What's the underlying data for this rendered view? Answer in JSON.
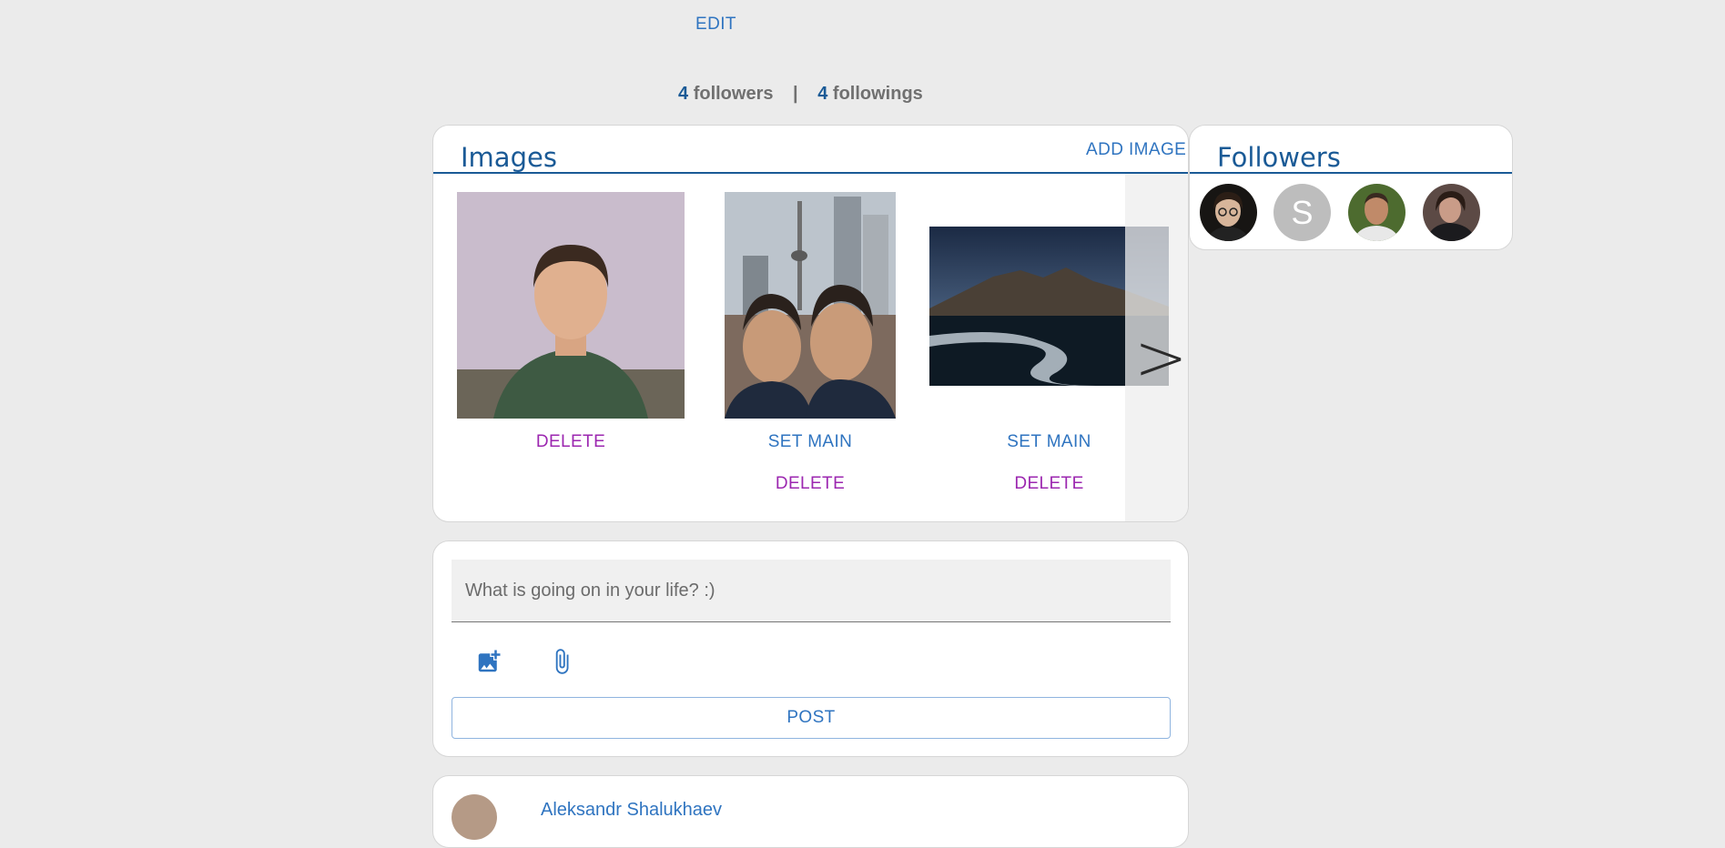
{
  "profile": {
    "edit_label": "EDIT",
    "followers_count": "4",
    "followers_label": "followers",
    "separator": "|",
    "followings_count": "4",
    "followings_label": "followings"
  },
  "images_card": {
    "title": "Images",
    "add_label": "ADD IMAGE",
    "items": [
      {
        "alt": "portrait-photo",
        "actions": [
          "DELETE"
        ]
      },
      {
        "alt": "city-selfie-photo",
        "actions": [
          "SET MAIN",
          "DELETE"
        ]
      },
      {
        "alt": "black-sand-beach-landscape",
        "actions": [
          "SET MAIN",
          "DELETE"
        ]
      }
    ],
    "next_icon": "chevron-right-icon",
    "next_glyph": ">"
  },
  "followers_card": {
    "title": "Followers",
    "avatars": [
      {
        "name": "follower-avatar-1"
      },
      {
        "name": "follower-avatar-2",
        "initial": "S"
      },
      {
        "name": "follower-avatar-3"
      },
      {
        "name": "follower-avatar-4"
      }
    ]
  },
  "composer": {
    "placeholder": "What is going on in your life? :)",
    "add_image_icon": "add-photo-icon",
    "attach_icon": "paperclip-icon",
    "post_label": "POST"
  },
  "feed": {
    "first_author": "Aleksandr Shalukhaev"
  },
  "colors": {
    "background": "#ebebeb",
    "title_blue": "#1a5a96",
    "action_blue": "#2f74c0",
    "delete_purple": "#9c27b0"
  }
}
